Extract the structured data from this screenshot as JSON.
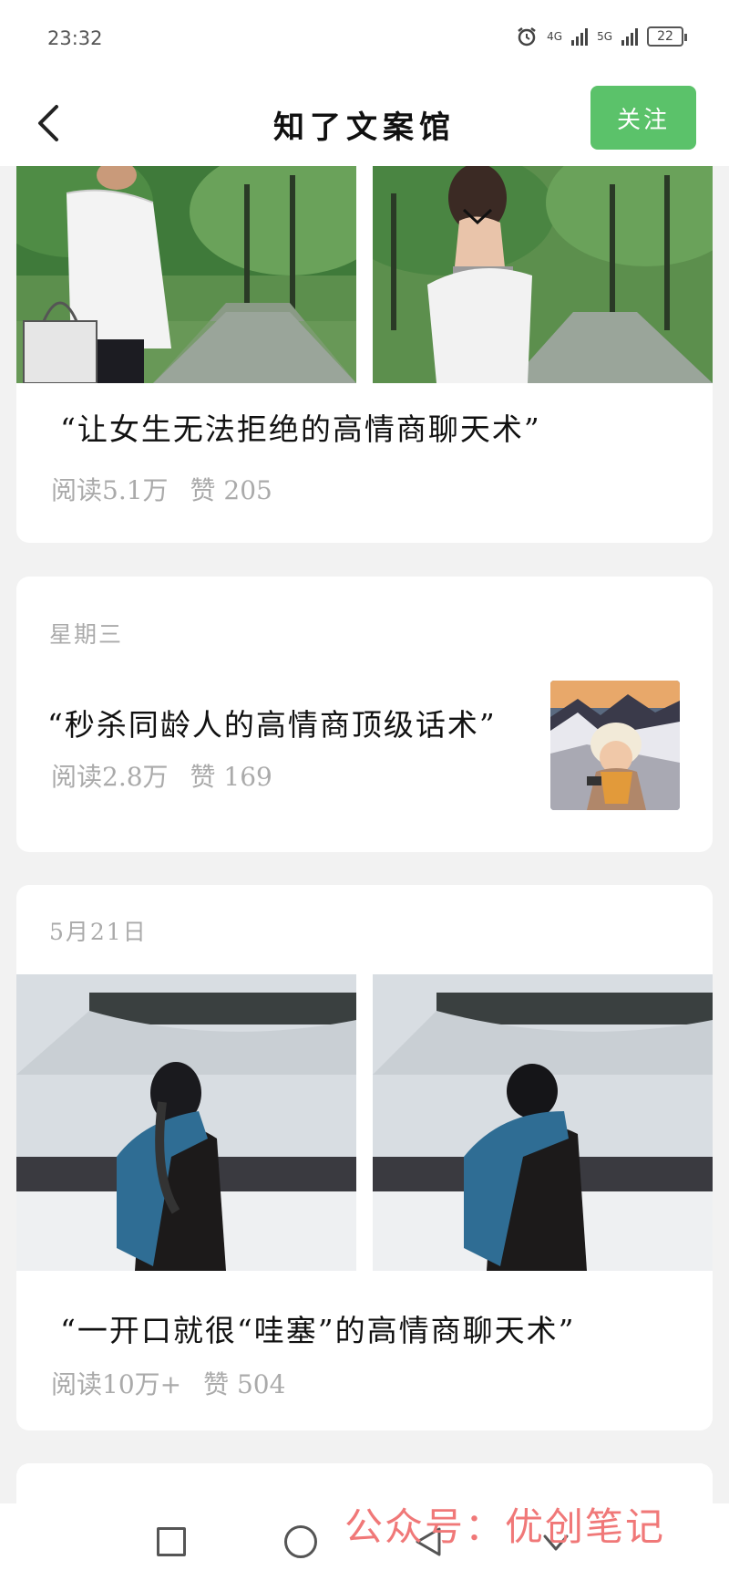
{
  "status_bar": {
    "time": "23:32",
    "net1": "4G",
    "net2": "5G",
    "battery": "22"
  },
  "header": {
    "title": "知了文案馆",
    "follow_label": "关注"
  },
  "articles": [
    {
      "date": "",
      "title": "“让女生无法拒绝的高情商聊天术”",
      "reads": "阅读5.1万",
      "likes": "赞 205",
      "layout": "image-pair"
    },
    {
      "date": "星期三",
      "title": "“秒杀同龄人的高情商顶级话术”",
      "reads": "阅读2.8万",
      "likes": "赞 169",
      "layout": "thumbnail"
    },
    {
      "date": "5月21日",
      "title": "“一开口就很“哇塞”的高情商聊天术”",
      "reads": "阅读10万+",
      "likes": "赞 504",
      "layout": "image-pair"
    }
  ],
  "watermark": "公众号：优创笔记",
  "colors": {
    "accent": "#5bc26a",
    "meta": "#aaaaaa",
    "watermark": "#f07878"
  },
  "icons": [
    "back-chevron-icon",
    "alarm-icon",
    "signal-icon",
    "battery-icon",
    "recent-apps-icon",
    "home-icon",
    "back-icon",
    "down-icon"
  ]
}
